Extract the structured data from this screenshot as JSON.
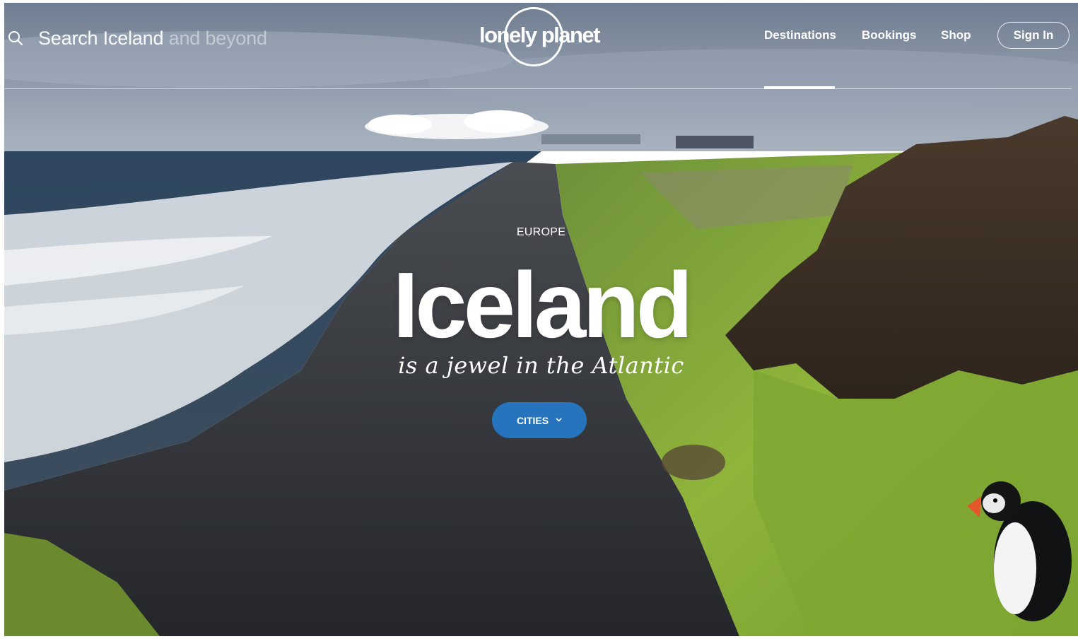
{
  "header": {
    "search": {
      "primary": "Search Iceland",
      "faded": " and beyond"
    },
    "logo_text": "lonely planet",
    "nav": [
      {
        "label": "Destinations",
        "active": true
      },
      {
        "label": "Bookings",
        "active": false
      },
      {
        "label": "Shop",
        "active": false
      }
    ],
    "signin_label": "Sign In"
  },
  "hero": {
    "region": "EUROPE",
    "title": "Iceland",
    "tagline": "is a jewel in the Atlantic",
    "cta_label": "CITIES"
  },
  "icons": {
    "search": "search-icon",
    "chevron": "chevron-down-icon"
  },
  "colors": {
    "accent": "#2574bd",
    "text": "#ffffff"
  }
}
